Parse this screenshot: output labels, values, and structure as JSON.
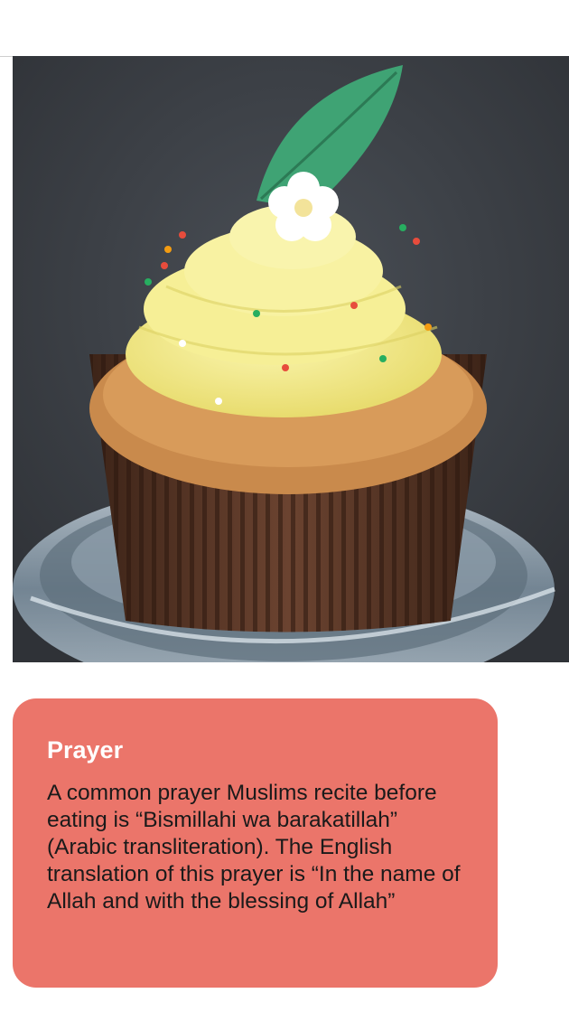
{
  "photo": {
    "subject": "cupcake-photo",
    "colors": {
      "background": "#3a3e44",
      "frosting": "#f3ec8c",
      "liner": "#5a3422",
      "cake": "#c98a4c",
      "leaf": "#3fa374",
      "flower": "#ffffff",
      "stand": "#9fb4c4"
    }
  },
  "prayer": {
    "title": "Prayer",
    "body": "A common prayer Muslims recite before eating is “Bismillahi wa barakatillah” (Arabic transliteration). The English translation of this prayer is “In the name of Allah and with the blessing of Allah”",
    "background_color": "#eb756a",
    "title_color": "#ffffff"
  }
}
